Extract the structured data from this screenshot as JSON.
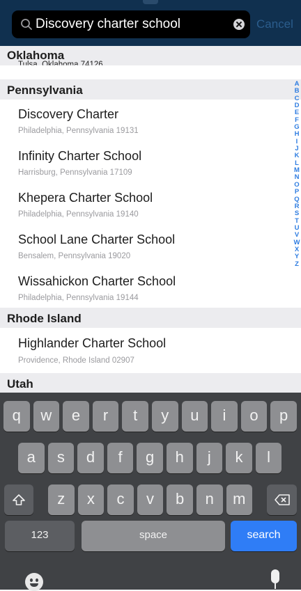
{
  "search": {
    "query": "Discovery charter school",
    "cancel_label": "Cancel"
  },
  "results": {
    "partial_section": {
      "title": "Oklahoma",
      "cut_address": "Tulsa, Oklahoma 74126"
    },
    "sections": [
      {
        "title": "Pennsylvania",
        "items": [
          {
            "name": "Discovery Charter",
            "address": "Philadelphia, Pennsylvania 19131"
          },
          {
            "name": "Infinity Charter School",
            "address": "Harrisburg, Pennsylvania 17109"
          },
          {
            "name": "Khepera Charter School",
            "address": "Philadelphia, Pennsylvania 19140"
          },
          {
            "name": "School Lane Charter School",
            "address": "Bensalem, Pennsylvania 19020"
          },
          {
            "name": "Wissahickon Charter School",
            "address": "Philadelphia, Pennsylvania 19144"
          }
        ]
      },
      {
        "title": "Rhode Island",
        "items": [
          {
            "name": "Highlander Charter School",
            "address": "Providence, Rhode Island 02907"
          }
        ]
      },
      {
        "title": "Utah",
        "items": []
      }
    ]
  },
  "index_letters": [
    "A",
    "B",
    "C",
    "D",
    "E",
    "F",
    "G",
    "H",
    "I",
    "J",
    "K",
    "L",
    "M",
    "N",
    "O",
    "P",
    "Q",
    "R",
    "S",
    "T",
    "U",
    "V",
    "W",
    "X",
    "Y",
    "Z"
  ],
  "keyboard": {
    "row1": [
      "q",
      "w",
      "e",
      "r",
      "t",
      "y",
      "u",
      "i",
      "o",
      "p"
    ],
    "row2": [
      "a",
      "s",
      "d",
      "f",
      "g",
      "h",
      "j",
      "k",
      "l"
    ],
    "row3": [
      "z",
      "x",
      "c",
      "v",
      "b",
      "n",
      "m"
    ],
    "numbers_label": "123",
    "space_label": "space",
    "search_label": "search"
  },
  "colors": {
    "accent": "#2f7df6",
    "header": "#10304f",
    "index": "#2f7de1"
  },
  "icons": {
    "search": "magnifier-icon",
    "clear": "clear-icon",
    "shift": "shift-icon",
    "delete": "backspace-icon",
    "emoji": "emoji-icon",
    "mic": "microphone-icon"
  }
}
